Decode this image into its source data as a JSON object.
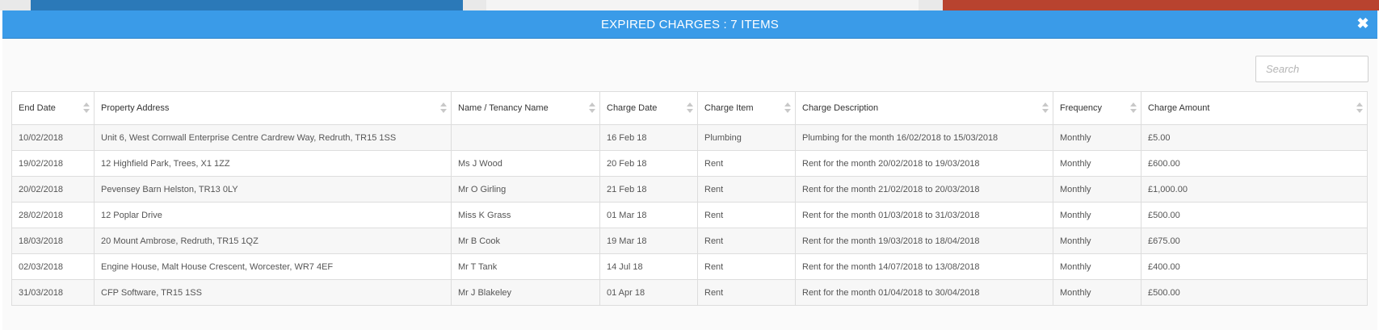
{
  "modal": {
    "title": "EXPIRED CHARGES : 7 ITEMS",
    "close_icon": "close-icon",
    "close_glyph": "✖"
  },
  "search": {
    "placeholder": "Search",
    "value": ""
  },
  "table": {
    "columns": [
      "End Date",
      "Property Address",
      "Name / Tenancy Name",
      "Charge Date",
      "Charge Item",
      "Charge Description",
      "Frequency",
      "Charge Amount"
    ],
    "rows": [
      [
        "10/02/2018",
        "Unit 6, West Cornwall Enterprise Centre Cardrew Way, Redruth, TR15 1SS",
        "",
        "16 Feb 18",
        "Plumbing",
        "Plumbing for the month 16/02/2018 to 15/03/2018",
        "Monthly",
        "£5.00"
      ],
      [
        "19/02/2018",
        "12 Highfield Park, Trees, X1 1ZZ",
        "Ms J Wood",
        "20 Feb 18",
        "Rent",
        "Rent for the month 20/02/2018 to 19/03/2018",
        "Monthly",
        "£600.00"
      ],
      [
        "20/02/2018",
        "Pevensey Barn Helston, TR13 0LY",
        "Mr O Girling",
        "21 Feb 18",
        "Rent",
        "Rent for the month 21/02/2018 to 20/03/2018",
        "Monthly",
        "£1,000.00"
      ],
      [
        "28/02/2018",
        "12 Poplar Drive",
        "Miss K Grass",
        "01 Mar 18",
        "Rent",
        "Rent for the month 01/03/2018 to 31/03/2018",
        "Monthly",
        "£500.00"
      ],
      [
        "18/03/2018",
        "20 Mount Ambrose, Redruth, TR15 1QZ",
        "Mr B Cook",
        "19 Mar 18",
        "Rent",
        "Rent for the month 19/03/2018 to 18/04/2018",
        "Monthly",
        "£675.00"
      ],
      [
        "02/03/2018",
        "Engine House, Malt House Crescent, Worcester, WR7 4EF",
        "Mr T Tank",
        "14 Jul 18",
        "Rent",
        "Rent for the month 14/07/2018 to 13/08/2018",
        "Monthly",
        "£400.00"
      ],
      [
        "31/03/2018",
        "CFP Software, TR15 1SS",
        "Mr J Blakeley",
        "01 Apr 18",
        "Rent",
        "Rent for the month 01/04/2018 to 30/04/2018",
        "Monthly",
        "£500.00"
      ]
    ]
  },
  "colors": {
    "header_blue": "#3a9be8",
    "row_alt": "#f7f7f7",
    "border": "#dddddd"
  }
}
